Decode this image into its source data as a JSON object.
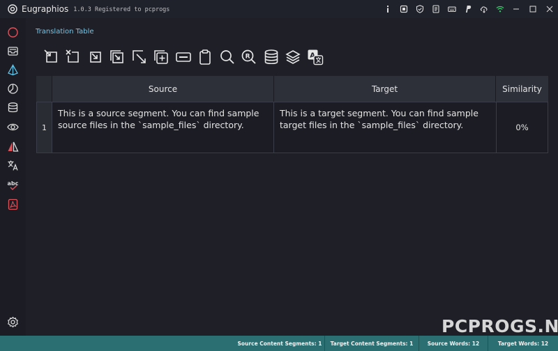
{
  "titlebar": {
    "app_name": "Eugraphios",
    "version_text": "1.0.3 Registered to pcprogs",
    "icons": [
      "info-icon",
      "cpu-icon",
      "shield-check-icon",
      "document-icon",
      "keyboard-icon",
      "paypal-icon",
      "cloud-download-icon",
      "wifi-icon",
      "minimize-icon",
      "maximize-icon",
      "close-icon"
    ]
  },
  "sidebar": {
    "items": [
      "circle-icon",
      "inbox-icon",
      "prism-icon",
      "chart-pie-icon",
      "database-icon",
      "eye-icon",
      "compare-icon",
      "translate-icon",
      "spellcheck-icon",
      "pdf-icon"
    ],
    "bottom": "settings-icon"
  },
  "main": {
    "section_title": "Translation Table",
    "toolbar": [
      "new-file-icon",
      "close-file-icon",
      "import-icon",
      "import-multiple-icon",
      "export-icon",
      "add-segment-icon",
      "merge-icon",
      "clipboard-icon",
      "search-icon",
      "search-replace-icon",
      "database-icon",
      "layers-icon",
      "translate-icon"
    ]
  },
  "table": {
    "columns": [
      "Source",
      "Target",
      "Similarity"
    ],
    "rows": [
      {
        "number": "1",
        "source": "This is a source segment. You can find sample source files in the `sample_files` directory.",
        "target": "This is a target segment. You can find sample target files in the `sample_files` directory.",
        "similarity": "0%"
      }
    ]
  },
  "watermark": "PCPROGS.NET",
  "statusbar": {
    "source_segments": "Source Content Segments: 1",
    "target_segments": "Target Content Segments: 1",
    "source_words": "Source Words: 12",
    "target_words": "Target Words: 12"
  },
  "colors": {
    "accent": "#79c5e6",
    "statusbar": "#2c6f72",
    "sidebar_red": "#e0525a"
  }
}
